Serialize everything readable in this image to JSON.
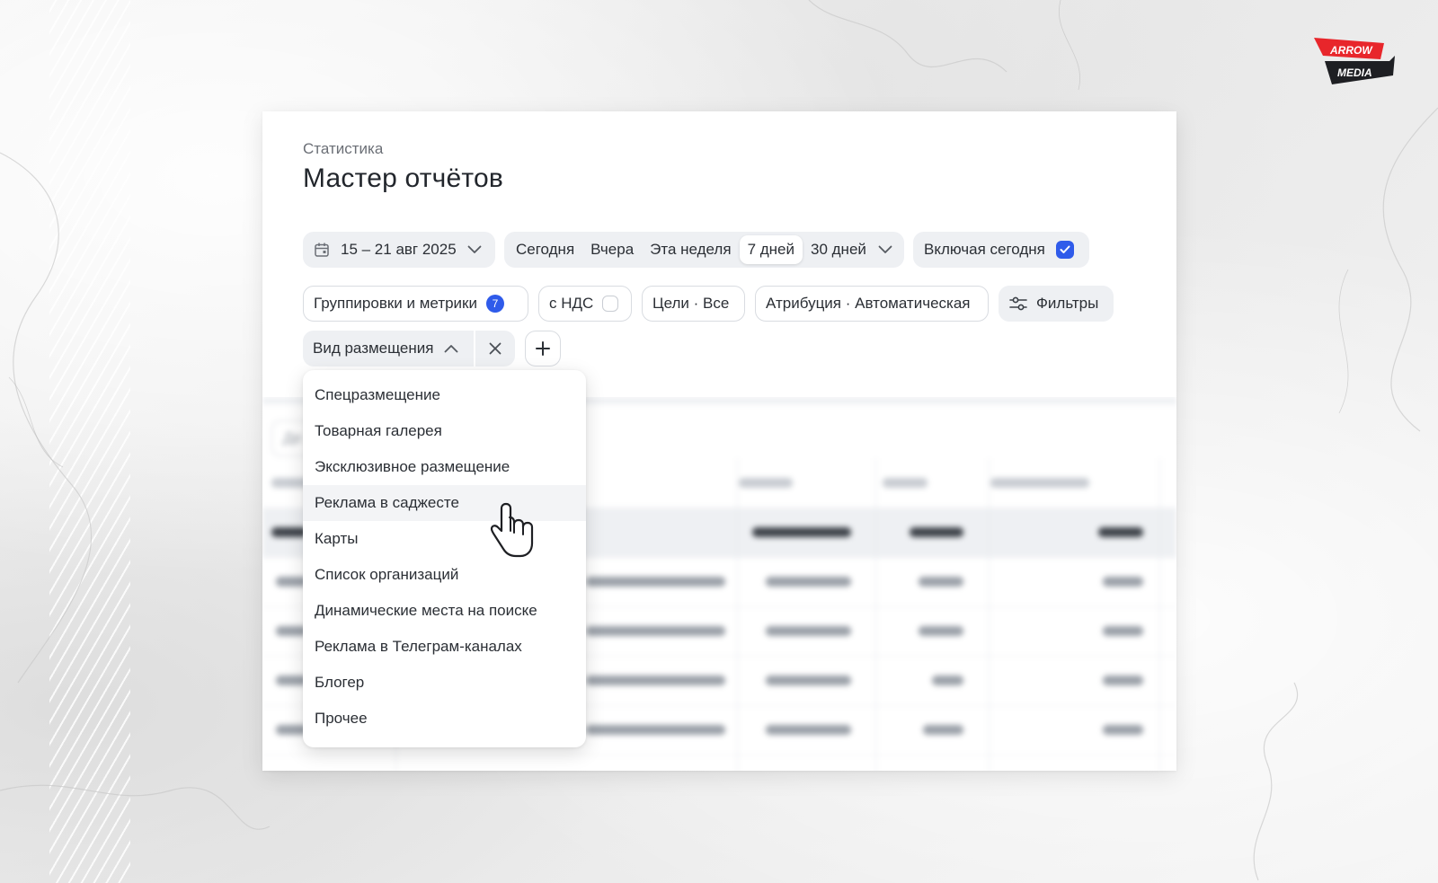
{
  "breadcrumb": "Статистика",
  "page_title": "Мастер отчётов",
  "date_picker": {
    "value": "15 – 21 авг 2025"
  },
  "quick_periods": {
    "items": [
      "Сегодня",
      "Вчера",
      "Эта неделя",
      "7 дней",
      "30 дней"
    ],
    "active": "7 дней"
  },
  "include_today": {
    "label": "Включая сегодня",
    "checked": true
  },
  "groupings": {
    "label": "Группировки и метрики",
    "badge": "7"
  },
  "vat": {
    "label": "с НДС",
    "checked": false
  },
  "goals": {
    "label": "Цели · Все"
  },
  "attribution": {
    "label": "Атрибуция · Автоматическая"
  },
  "filters": {
    "label": "Фильтры"
  },
  "placement_filter": {
    "label": "Вид размещения"
  },
  "table": {
    "search_placeholder": "Де"
  },
  "placement_options": [
    "Спецразмещение",
    "Товарная галерея",
    "Эксклюзивное размещение",
    "Реклама в саджесте",
    "Карты",
    "Список организаций",
    "Динамические места на поиске",
    "Реклама в Телеграм-каналах",
    "Блогер",
    "Прочее"
  ],
  "hovered_option": "Реклама в саджесте",
  "logo": {
    "line1": "ARROW",
    "line2": "MEDIA"
  },
  "colors": {
    "accent": "#2f5bea",
    "logo_red": "#e8262b",
    "logo_dark": "#1e1f23"
  }
}
